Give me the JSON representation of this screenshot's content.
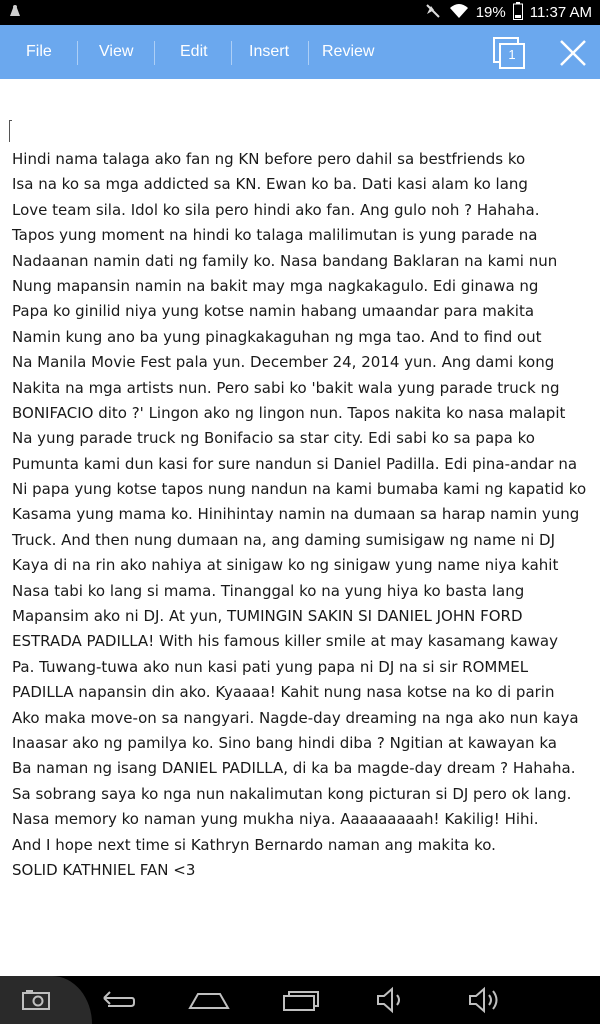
{
  "statusbar": {
    "battery": "19%",
    "time": "11:37 AM"
  },
  "toolbar": {
    "menu": [
      "File",
      "View",
      "Edit",
      "Insert",
      "Review"
    ],
    "page_count": "1"
  },
  "document": {
    "lines": [
      "Hindi nama talaga ako fan ng KN before pero dahil sa bestfriends ko",
      "Isa na ko sa mga addicted sa KN. Ewan ko ba. Dati kasi alam ko lang",
      "Love team sila. Idol ko sila pero hindi ako fan. Ang gulo noh ? Hahaha.",
      "Tapos yung moment na hindi ko talaga malilimutan is yung parade na",
      "Nadaanan namin dati ng family ko. Nasa bandang Baklaran na kami nun",
      "Nung mapansin namin na bakit may mga nagkakagulo. Edi ginawa ng",
      "Papa ko ginilid niya yung kotse namin habang umaandar para makita",
      "Namin kung ano ba yung pinagkakaguhan ng mga tao. And to find out",
      "Na Manila Movie Fest pala yun. December 24, 2014 yun. Ang dami kong",
      "Nakita na mga artists nun. Pero sabi ko 'bakit wala yung parade truck ng",
      "BONIFACIO dito ?' Lingon ako ng lingon nun. Tapos nakita ko nasa malapit",
      "Na yung parade truck ng Bonifacio sa star city. Edi sabi ko sa papa ko",
      "Pumunta kami dun kasi for sure nandun si Daniel Padilla. Edi pina-andar na",
      "Ni papa yung kotse tapos nung nandun na kami bumaba kami ng kapatid ko",
      "Kasama yung mama ko. Hinihintay namin na dumaan sa harap namin yung",
      "Truck. And then nung dumaan na, ang daming sumisigaw ng name ni DJ",
      "Kaya di na rin ako nahiya at sinigaw ko ng sinigaw yung name niya kahit",
      "Nasa tabi ko lang si mama. Tinanggal ko na yung hiya ko basta lang",
      "Mapansim ako ni DJ. At yun, TUMINGIN SAKIN SI DANIEL JOHN FORD",
      "ESTRADA PADILLA! With his famous killer smile at may kasamang kaway",
      "Pa. Tuwang-tuwa ako nun kasi pati yung papa ni DJ na si sir ROMMEL",
      "PADILLA napansin din ako. Kyaaaa! Kahit nung nasa kotse na ko di parin",
      "Ako maka move-on sa nangyari. Nagde-day dreaming na nga ako nun kaya",
      "Inaasar ako ng pamilya ko. Sino bang hindi diba ? Ngitian at kawayan ka",
      "Ba naman ng isang DANIEL PADILLA, di ka ba magde-day dream ? Hahaha.",
      "Sa sobrang saya ko nga nun nakalimutan kong picturan si DJ pero ok lang.",
      "Nasa memory ko naman yung mukha niya. Aaaaaaaaah! Kakilig! Hihi.",
      "And I hope next time si Kathryn Bernardo naman ang makita ko.",
      "SOLID KATHNIEL FAN <3"
    ]
  }
}
